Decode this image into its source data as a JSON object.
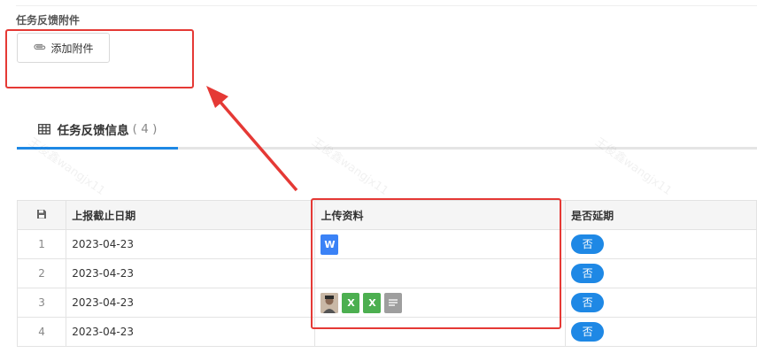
{
  "attachment": {
    "title": "任务反馈附件",
    "add_button_label": "添加附件",
    "icon": "paperclip-icon"
  },
  "tab": {
    "label": "任务反馈信息",
    "count": "( 4 )",
    "icon": "table-icon"
  },
  "watermark": "王俊鑫wangjx11",
  "table": {
    "columns": [
      "上报截止日期",
      "上传资料",
      "是否延期"
    ],
    "header_icon": "save-icon",
    "rows": [
      {
        "index": "1",
        "date": "2023-04-23",
        "files": [
          {
            "type": "word",
            "label": "W"
          }
        ],
        "delayed": "否"
      },
      {
        "index": "2",
        "date": "2023-04-23",
        "files": [],
        "delayed": "否"
      },
      {
        "index": "3",
        "date": "2023-04-23",
        "files": [
          {
            "type": "photo",
            "label": ""
          },
          {
            "type": "excel",
            "label": "X"
          },
          {
            "type": "excel",
            "label": "X"
          },
          {
            "type": "doc",
            "label": ""
          }
        ],
        "delayed": "否"
      },
      {
        "index": "4",
        "date": "2023-04-23",
        "files": [],
        "delayed": "否"
      }
    ]
  },
  "annotation_color": "#e53935",
  "accent_color": "#1e88e5"
}
